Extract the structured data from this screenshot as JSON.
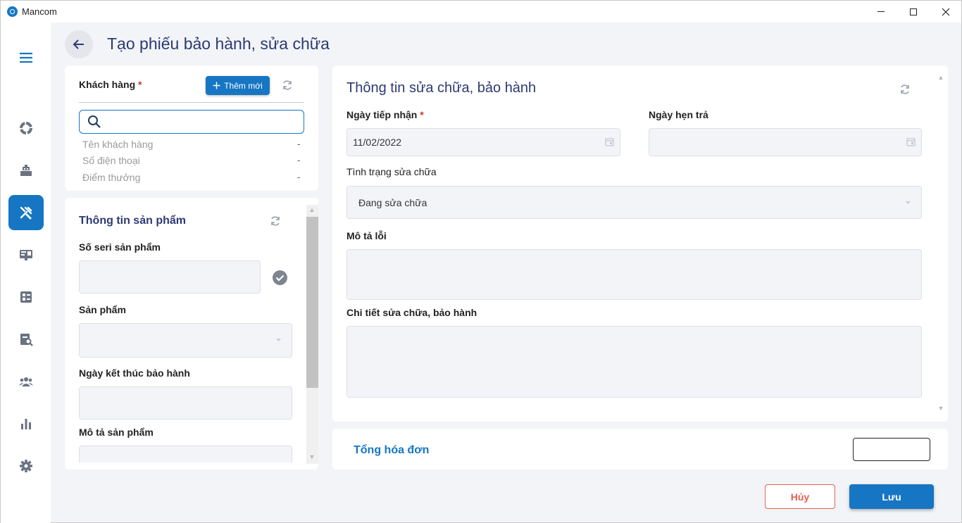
{
  "app": {
    "title": "Mancom",
    "accent_color": "#1676c3",
    "title_color": "#2c3a73",
    "danger_color": "#e2624f"
  },
  "sidebar": {
    "items": [
      {
        "icon": "menu-icon"
      },
      {
        "icon": "dashboard-icon"
      },
      {
        "icon": "cash-register-icon"
      },
      {
        "icon": "tools-icon",
        "active": true
      },
      {
        "icon": "monitor-icon"
      },
      {
        "icon": "catalog-icon"
      },
      {
        "icon": "search-report-icon"
      },
      {
        "icon": "users-icon"
      },
      {
        "icon": "bar-chart-icon"
      },
      {
        "icon": "gear-icon"
      }
    ]
  },
  "header": {
    "title": "Tạo phiếu bảo hành, sửa chữa"
  },
  "customer": {
    "label": "Khách hàng",
    "required_mark": "*",
    "add_button": "Thêm mới",
    "search_value": "",
    "fields": [
      {
        "label": "Tên khách hàng",
        "value": "-"
      },
      {
        "label": "Số điện thoại",
        "value": "-"
      },
      {
        "label": "Điểm thưởng",
        "value": "-"
      }
    ]
  },
  "product": {
    "title": "Thông tin sản phẩm",
    "serial_label": "Số seri sản phẩm",
    "serial_value": "",
    "product_label": "Sản phẩm",
    "product_value": "",
    "warranty_end_label": "Ngày kết thúc bảo hành",
    "warranty_end_value": "",
    "description_label": "Mô tả sản phẩm",
    "description_value": ""
  },
  "repair": {
    "title": "Thông tin sửa chữa, bảo hành",
    "received_label": "Ngày tiếp nhận",
    "required_mark": "*",
    "received_value": "11/02/2022",
    "return_label": "Ngày hẹn trả",
    "return_value": "",
    "status_label": "Tình trạng sửa chữa",
    "status_value": "Đang sửa chữa",
    "error_label": "Mô tả lỗi",
    "error_value": "",
    "detail_label": "Chi tiết sửa chữa, bảo hành",
    "detail_value": ""
  },
  "total": {
    "label": "Tổng hóa đơn",
    "value": ""
  },
  "actions": {
    "cancel": "Hủy",
    "save": "Lưu"
  }
}
